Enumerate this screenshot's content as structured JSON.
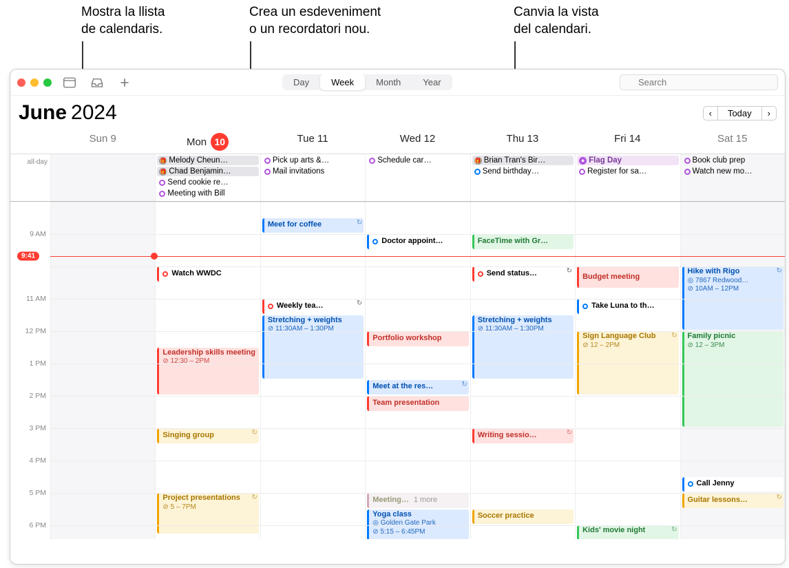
{
  "callouts": {
    "list": "Mostra la llista\nde calendaris.",
    "create": "Crea un esdeveniment\no un recordatori nou.",
    "view": "Canvia la vista\ndel calendari."
  },
  "toolbar": {
    "seg": [
      "Day",
      "Week",
      "Month",
      "Year"
    ],
    "activeSeg": 1,
    "searchPlaceholder": "Search"
  },
  "title": {
    "month": "June",
    "year": "2024",
    "today": "Today"
  },
  "days": [
    {
      "label": "Sun 9",
      "wknd": true
    },
    {
      "label": "Mon ",
      "num": "10",
      "today": true
    },
    {
      "label": "Tue 11"
    },
    {
      "label": "Wed 12"
    },
    {
      "label": "Thu 13"
    },
    {
      "label": "Fri 14"
    },
    {
      "label": "Sat 15",
      "wknd": true
    }
  ],
  "allDayLabel": "all-day",
  "allDay": [
    [],
    [
      {
        "style": "bday",
        "text": "Melody Cheun…"
      },
      {
        "style": "bday",
        "text": "Chad Benjamin…"
      },
      {
        "ring": "#af52de",
        "text": "Send cookie re…"
      },
      {
        "ring": "#af52de",
        "text": "Meeting with Bill"
      }
    ],
    [
      {
        "ring": "#af52de",
        "text": "Pick up arts &…"
      },
      {
        "ring": "#af52de",
        "text": "Mail invitations"
      }
    ],
    [
      {
        "ring": "#af52de",
        "text": "Schedule car…"
      }
    ],
    [
      {
        "style": "bday",
        "text": "Brian Tran's Bir…"
      },
      {
        "ring": "#007aff",
        "text": "Send birthday…"
      }
    ],
    [
      {
        "style": "hol",
        "fill": "#af52de",
        "text": "Flag Day"
      },
      {
        "ring": "#af52de",
        "text": "Register for sa…"
      }
    ],
    [
      {
        "ring": "#af52de",
        "text": "Book club prep"
      },
      {
        "ring": "#af52de",
        "text": "Watch new mo…"
      }
    ]
  ],
  "hours": {
    "start": 8,
    "end": 18.5,
    "pxPerHour": 47,
    "labels": [
      {
        "h": 9,
        "t": "9 AM"
      },
      {
        "h": 11,
        "t": "11 AM"
      },
      {
        "h": 12,
        "t": "12 PM"
      },
      {
        "h": 13,
        "t": "1 PM"
      },
      {
        "h": 14,
        "t": "2 PM"
      },
      {
        "h": 15,
        "t": "3 PM"
      },
      {
        "h": 16,
        "t": "4 PM"
      },
      {
        "h": 17,
        "t": "5 PM"
      },
      {
        "h": 18,
        "t": "6 PM"
      }
    ],
    "now": {
      "time": "9:41",
      "h": 9.68,
      "dotCol": 1
    }
  },
  "events": [
    {
      "col": 1,
      "start": 10,
      "end": 10.5,
      "bg": "#fff",
      "bc": "#ff3b30",
      "ring": "#ff3b30",
      "title": "Watch WWDC",
      "short": true
    },
    {
      "col": 1,
      "start": 12.5,
      "end": 14,
      "bg": "#ffe1df",
      "bc": "#ff3b30",
      "tc": "#c0302a",
      "title": "Leadership skills meeting",
      "sub": "⊘ 12:30 – 2PM"
    },
    {
      "col": 1,
      "start": 15,
      "end": 15.5,
      "bg": "#fdf3d6",
      "bc": "#f0a500",
      "tc": "#a87700",
      "title": "Singing group",
      "recur": true,
      "short": true
    },
    {
      "col": 1,
      "start": 17,
      "end": 18.3,
      "bg": "#fdf3d6",
      "bc": "#f0a500",
      "tc": "#a87700",
      "title": "Project presentations",
      "sub": "⊘ 5 – 7PM",
      "recur": true
    },
    {
      "col": 2,
      "start": 8.5,
      "end": 9,
      "bg": "#dceaff",
      "bc": "#007aff",
      "tc": "#0051b0",
      "title": "Meet for coffee",
      "recur": true,
      "short": true
    },
    {
      "col": 2,
      "start": 11,
      "end": 11.5,
      "bg": "#fff",
      "bc": "#ff3b30",
      "ring": "#ff3b30",
      "title": "Weekly tea…",
      "recur": true,
      "short": true
    },
    {
      "col": 2,
      "start": 11.5,
      "end": 13.5,
      "bg": "#dceaff",
      "bc": "#007aff",
      "tc": "#0051b0",
      "title": "Stretching + weights",
      "sub": "⊘ 11:30AM – 1:30PM"
    },
    {
      "col": 3,
      "start": 9,
      "end": 9.5,
      "bg": "#fff",
      "bc": "#007aff",
      "ring": "#007aff",
      "title": "Doctor appoint…",
      "short": true
    },
    {
      "col": 3,
      "start": 12,
      "end": 12.5,
      "bg": "#ffe1df",
      "bc": "#ff3b30",
      "tc": "#c0302a",
      "title": "Portfolio workshop",
      "short": true
    },
    {
      "col": 3,
      "start": 13.5,
      "end": 14,
      "bg": "#dceaff",
      "bc": "#007aff",
      "tc": "#0051b0",
      "title": "Meet at the res…",
      "recur": true,
      "short": true
    },
    {
      "col": 3,
      "start": 14,
      "end": 14.5,
      "bg": "#ffe1df",
      "bc": "#ff3b30",
      "tc": "#c0302a",
      "title": "Team presentation",
      "short": true
    },
    {
      "col": 3,
      "start": 17,
      "end": 17.5,
      "bg": "#f6f1f3",
      "bc": "#d5a9b8",
      "tc": "#997",
      "title": "Meeting…",
      "more": "1 more",
      "short": true
    },
    {
      "col": 3,
      "start": 17.5,
      "end": 18.5,
      "bg": "#dceaff",
      "bc": "#007aff",
      "tc": "#0051b0",
      "title": "Yoga class",
      "sub": "◎ Golden Gate Park",
      "sub2": "⊘ 5:15 – 6:45PM"
    },
    {
      "col": 4,
      "start": 9,
      "end": 9.5,
      "bg": "#e2f6e6",
      "bc": "#34c759",
      "tc": "#1f7a35",
      "title": "FaceTime with Gr…",
      "short": true
    },
    {
      "col": 4,
      "start": 10,
      "end": 10.5,
      "bg": "#fff",
      "bc": "#ff3b30",
      "ring": "#ff3b30",
      "title": "Send status…",
      "recur": true,
      "short": true
    },
    {
      "col": 4,
      "start": 11.5,
      "end": 13.5,
      "bg": "#dceaff",
      "bc": "#007aff",
      "tc": "#0051b0",
      "title": "Stretching + weights",
      "sub": "⊘ 11:30AM – 1:30PM"
    },
    {
      "col": 4,
      "start": 15,
      "end": 15.5,
      "bg": "#ffe1df",
      "bc": "#ff3b30",
      "tc": "#c0302a",
      "title": "Writing sessio…",
      "recur": true,
      "short": true
    },
    {
      "col": 4,
      "start": 17.5,
      "end": 18,
      "bg": "#fdf3d6",
      "bc": "#f0a500",
      "tc": "#a87700",
      "title": "Soccer practice",
      "short": true
    },
    {
      "col": 5,
      "start": 10,
      "end": 10.7,
      "bg": "#ffe1df",
      "bc": "#ff3b30",
      "tc": "#c0302a",
      "title": "Budget meeting",
      "short": true
    },
    {
      "col": 5,
      "start": 11,
      "end": 11.5,
      "bg": "#fff",
      "bc": "#007aff",
      "ring": "#007aff",
      "title": "Take Luna to th…",
      "short": true
    },
    {
      "col": 5,
      "start": 12,
      "end": 14,
      "bg": "#fdf3d6",
      "bc": "#f0a500",
      "tc": "#a87700",
      "title": "Sign Language Club",
      "sub": "⊘ 12 – 2PM",
      "recur": true
    },
    {
      "col": 5,
      "start": 18,
      "end": 18.5,
      "bg": "#e2f6e6",
      "bc": "#34c759",
      "tc": "#1f7a35",
      "title": "Kids' movie night",
      "recur": true
    },
    {
      "col": 6,
      "start": 10,
      "end": 12,
      "bg": "#dceaff",
      "bc": "#007aff",
      "tc": "#0051b0",
      "title": "Hike with Rigo",
      "sub": "◎ 7867 Redwood…",
      "sub2": "⊘ 10AM – 12PM",
      "recur": true
    },
    {
      "col": 6,
      "start": 12,
      "end": 15,
      "bg": "#e2f6e6",
      "bc": "#34c759",
      "tc": "#1f7a35",
      "title": "Family picnic",
      "sub": "⊘ 12 – 3PM"
    },
    {
      "col": 6,
      "start": 16.5,
      "end": 17,
      "bg": "#fff",
      "bc": "#007aff",
      "ring": "#007aff",
      "title": "Call Jenny",
      "short": true
    },
    {
      "col": 6,
      "start": 17,
      "end": 17.5,
      "bg": "#fdf3d6",
      "bc": "#f0a500",
      "tc": "#a87700",
      "title": "Guitar lessons…",
      "recur": true,
      "short": true
    }
  ]
}
